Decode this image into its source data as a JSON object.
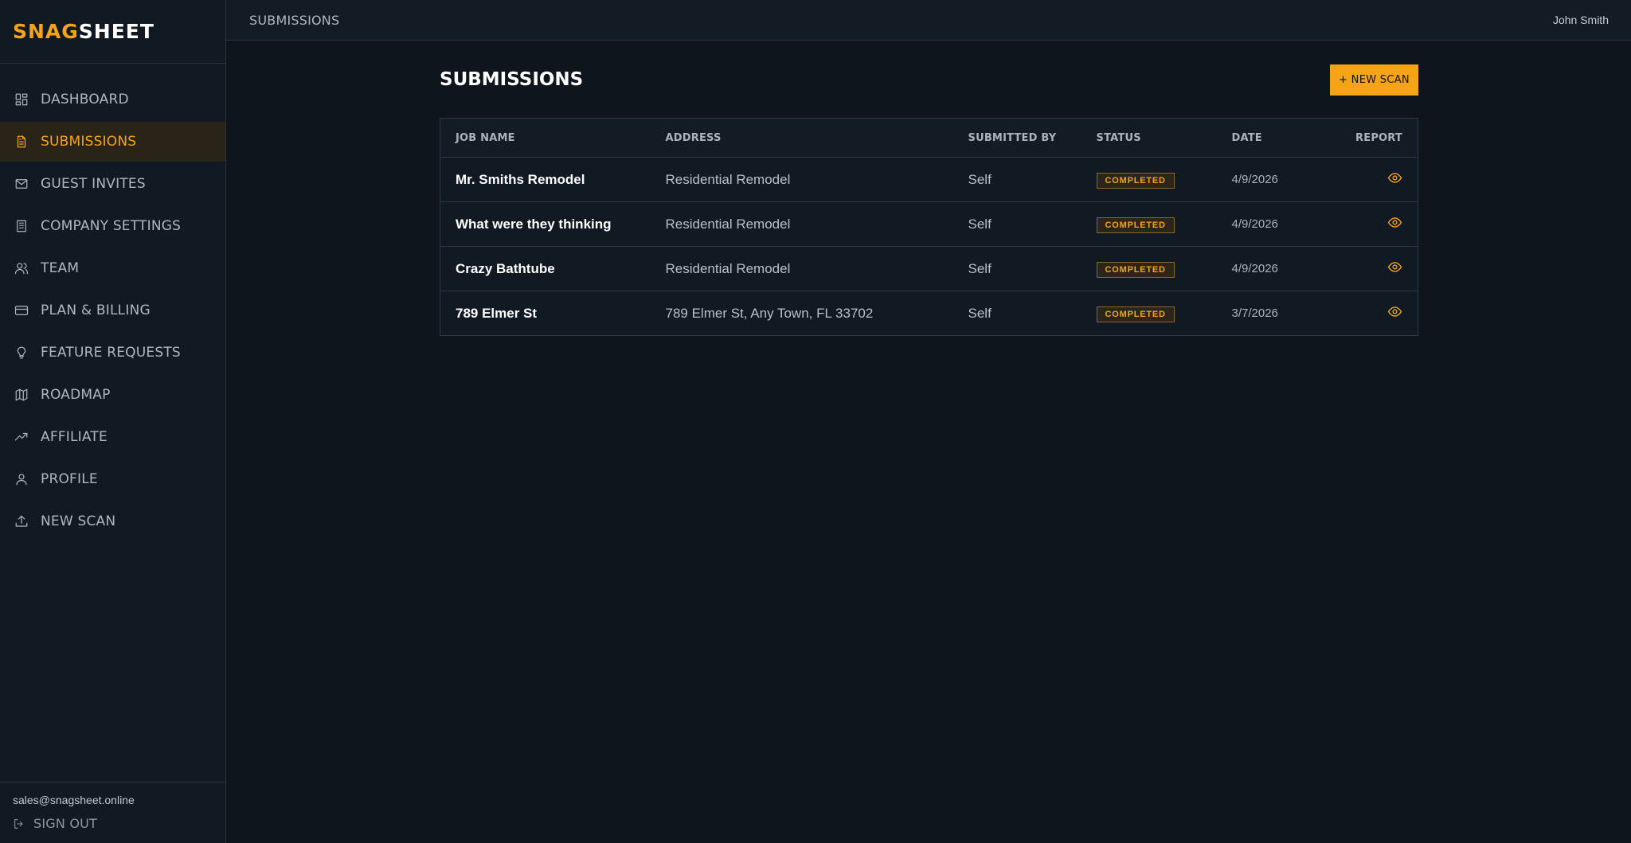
{
  "brand": {
    "part1": "SNAG",
    "part2": "SHEET"
  },
  "sidebar": {
    "items": [
      {
        "label": "Dashboard",
        "icon": "dashboard-icon"
      },
      {
        "label": "Submissions",
        "icon": "document-icon",
        "active": true
      },
      {
        "label": "Guest Invites",
        "icon": "mail-icon"
      },
      {
        "label": "Company Settings",
        "icon": "building-icon"
      },
      {
        "label": "Team",
        "icon": "users-icon"
      },
      {
        "label": "Plan & Billing",
        "icon": "credit-card-icon"
      },
      {
        "label": "Feature Requests",
        "icon": "lightbulb-icon"
      },
      {
        "label": "Roadmap",
        "icon": "map-icon"
      },
      {
        "label": "Affiliate",
        "icon": "trending-up-icon"
      },
      {
        "label": "Profile",
        "icon": "user-icon"
      },
      {
        "label": "New Scan",
        "icon": "upload-icon"
      }
    ],
    "email": "sales@snagsheet.online",
    "signout": "Sign Out"
  },
  "topbar": {
    "breadcrumb": "Submissions",
    "user": "John Smith"
  },
  "main": {
    "title": "Submissions",
    "new_scan_label": "+ New Scan",
    "columns": [
      "Job Name",
      "Address",
      "Submitted By",
      "Status",
      "Date",
      "Report"
    ],
    "rows": [
      {
        "job": "Mr. Smiths Remodel",
        "address": "Residential Remodel",
        "by": "Self",
        "status": "Completed",
        "date": "4/9/2026"
      },
      {
        "job": "What were they thinking",
        "address": "Residential Remodel",
        "by": "Self",
        "status": "Completed",
        "date": "4/9/2026"
      },
      {
        "job": "Crazy Bathtube",
        "address": "Residential Remodel",
        "by": "Self",
        "status": "Completed",
        "date": "4/9/2026"
      },
      {
        "job": "789 Elmer St",
        "address": "789 Elmer St, Any Town, FL 33702",
        "by": "Self",
        "status": "Completed",
        "date": "3/7/2026"
      }
    ]
  },
  "colors": {
    "accent": "#f5a416",
    "background": "#0e151d",
    "sidebar": "#111922"
  }
}
